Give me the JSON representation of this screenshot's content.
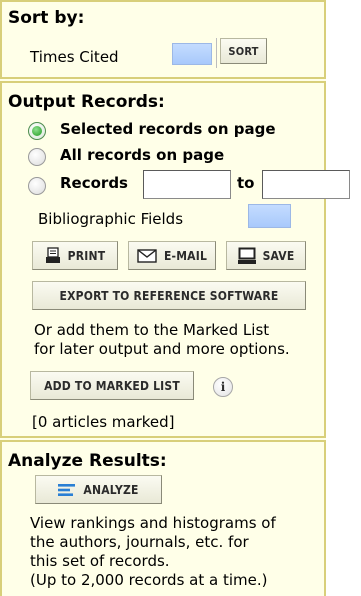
{
  "sort": {
    "heading": "Sort by:",
    "field_value": "Times Cited",
    "sort_button": "SORT"
  },
  "output": {
    "heading": "Output Records:",
    "options": [
      {
        "label": "Selected records on page",
        "selected": true
      },
      {
        "label": "All records on page",
        "selected": false
      },
      {
        "label": "Records",
        "selected": false
      }
    ],
    "range_to_label": "to",
    "range_from_value": "",
    "range_to_value": "",
    "fields_label": "Bibliographic Fields",
    "print_button": "PRINT",
    "email_button": "E-MAIL",
    "save_button": "SAVE",
    "export_button": "EXPORT TO REFERENCE SOFTWARE",
    "marked_hint_line1": "Or add them to the Marked List",
    "marked_hint_line2": "for later output and more options.",
    "add_marked_button": "ADD TO MARKED LIST",
    "info_glyph": "i",
    "marked_count": "[0 articles marked]"
  },
  "analyze": {
    "heading": "Analyze Results:",
    "analyze_button": "ANALYZE",
    "desc_line1": "View rankings and histograms of",
    "desc_line2": "the authors, journals, etc. for",
    "desc_line3": "this set of records.",
    "desc_line4": "(Up to 2,000 records at a time.)"
  },
  "colors": {
    "panel_bg": "#ffffe8",
    "border": "#d8cf7a",
    "select_blue": "#b4d0ff",
    "analyze_icon": "#2a7fd4"
  },
  "icons": {
    "print": "printer-icon",
    "email": "envelope-icon",
    "save": "computer-icon",
    "analyze": "bars-icon",
    "info": "info-icon"
  }
}
